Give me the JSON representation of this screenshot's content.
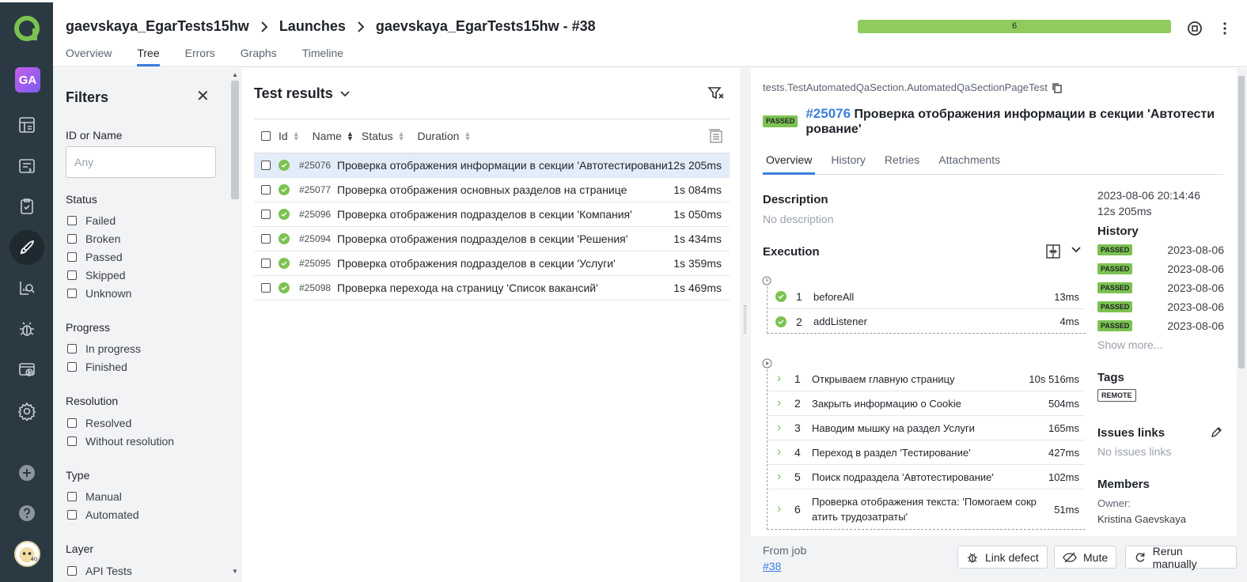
{
  "header": {
    "breadcrumbs": [
      "gaevskaya_EgarTests15hw",
      "Launches",
      "gaevskaya_EgarTests15hw - #38"
    ],
    "tabs": [
      "Overview",
      "Tree",
      "Errors",
      "Graphs",
      "Timeline"
    ],
    "active_tab": "Tree",
    "progress_label": "6",
    "progress_fraction": 1.0
  },
  "rail": {
    "project_avatar": "GA",
    "user_avatar_label": "40",
    "icons": [
      "dashboard-icon",
      "testcases-icon",
      "testplans-icon",
      "launches-icon",
      "analytics-icon",
      "defects-icon",
      "jobs-icon",
      "settings-icon",
      "add-icon",
      "help-icon"
    ]
  },
  "filters": {
    "title": "Filters",
    "id_or_name_label": "ID or Name",
    "id_or_name_placeholder": "Any",
    "status_label": "Status",
    "status_options": [
      "Failed",
      "Broken",
      "Passed",
      "Skipped",
      "Unknown"
    ],
    "progress_label": "Progress",
    "progress_options": [
      "In progress",
      "Finished"
    ],
    "resolution_label": "Resolution",
    "resolution_options": [
      "Resolved",
      "Without resolution"
    ],
    "type_label": "Type",
    "type_options": [
      "Manual",
      "Automated"
    ],
    "layer_label": "Layer",
    "layer_options": [
      "API Tests"
    ]
  },
  "results": {
    "title": "Test results",
    "columns": [
      "Id",
      "Name",
      "Status",
      "Duration"
    ],
    "rows": [
      {
        "id": "#25076",
        "name": "Проверка отображения информации в секции 'Автотестирование'",
        "duration": "12s 205ms"
      },
      {
        "id": "#25077",
        "name": "Проверка отображения основных разделов на странице",
        "duration": "1s 084ms"
      },
      {
        "id": "#25096",
        "name": "Проверка отображения подразделов в секции 'Компания'",
        "duration": "1s 050ms"
      },
      {
        "id": "#25094",
        "name": "Проверка отображения подразделов в секции 'Решения'",
        "duration": "1s 434ms"
      },
      {
        "id": "#25095",
        "name": "Проверка отображения подразделов в секции 'Услуги'",
        "duration": "1s 359ms"
      },
      {
        "id": "#25098",
        "name": "Проверка перехода на страницу 'Список вакансий'",
        "duration": "1s 469ms"
      }
    ]
  },
  "detail": {
    "path": "tests.TestAutomatedQaSection.AutomatedQaSectionPageTest",
    "status": "PASSED",
    "id": "#25076",
    "title_line1": "Проверка отображения информации в секции 'Автотести",
    "title_line2": "рование'",
    "tabs": [
      "Overview",
      "History",
      "Retries",
      "Attachments"
    ],
    "description_label": "Description",
    "description_value": "No description",
    "execution_label": "Execution",
    "setup_steps": [
      {
        "n": "1",
        "name": "beforeAll",
        "duration": "13ms"
      },
      {
        "n": "2",
        "name": "addListener",
        "duration": "4ms"
      }
    ],
    "steps": [
      {
        "n": "1",
        "name": "Открываем главную страницу",
        "duration": "10s 516ms"
      },
      {
        "n": "2",
        "name": "Закрыть информацию о Cookie",
        "duration": "504ms"
      },
      {
        "n": "3",
        "name": "Наводим мышку на раздел Услуги",
        "duration": "165ms"
      },
      {
        "n": "4",
        "name": "Переход в раздел 'Тестирование'",
        "duration": "427ms"
      },
      {
        "n": "5",
        "name": "Поиск подраздела 'Автотестирование'",
        "duration": "102ms"
      },
      {
        "n": "6",
        "name": "Проверка отображения текста: 'Помогаем сокр",
        "name2": "атить трудозатраты'",
        "duration": "51ms"
      }
    ],
    "datetime": "2023-08-06 20:14:46",
    "duration": "12s 205ms",
    "history_label": "History",
    "history": [
      {
        "status": "PASSED",
        "date": "2023-08-06"
      },
      {
        "status": "PASSED",
        "date": "2023-08-06"
      },
      {
        "status": "PASSED",
        "date": "2023-08-06"
      },
      {
        "status": "PASSED",
        "date": "2023-08-06"
      },
      {
        "status": "PASSED",
        "date": "2023-08-06"
      }
    ],
    "show_more": "Show more...",
    "tags_label": "Tags",
    "tag": "REMOTE",
    "issues_label": "Issues links",
    "issues_value": "No issues links",
    "members_label": "Members",
    "owner_label": "Owner:",
    "owner_name": "Kristina Gaevskaya"
  },
  "footer": {
    "from_job_label": "From job",
    "job_link": "#38",
    "link_defect": "Link defect",
    "mute": "Mute",
    "rerun": "Rerun manually"
  },
  "colors": {
    "passed": "#7cc251",
    "accent": "#3d7ede",
    "rail": "#2b3a42",
    "progress": "#8fcb5d"
  }
}
